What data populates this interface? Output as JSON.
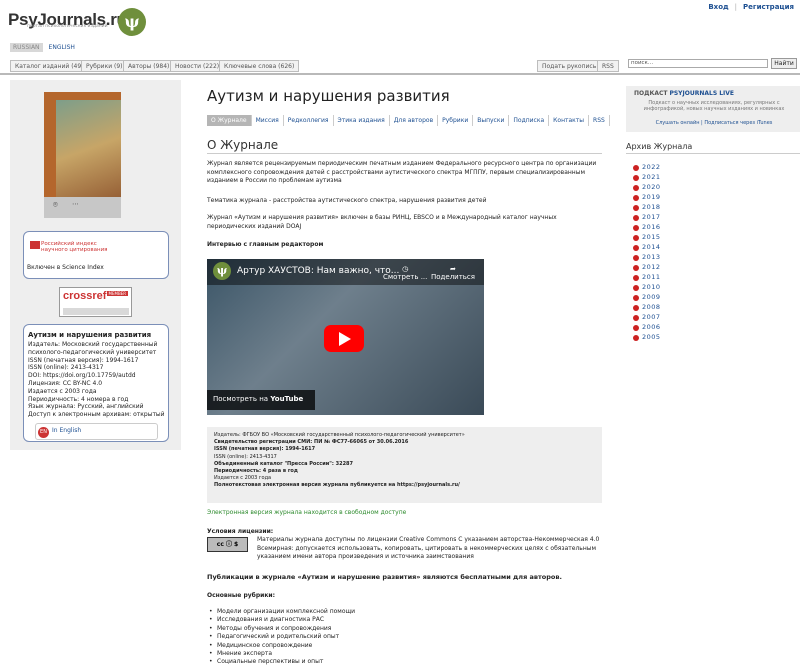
{
  "site": {
    "logo": "PsyJournals.ru",
    "subtitle": "портал психологических изданий",
    "logo_icon": "psi-icon"
  },
  "auth": {
    "login": "Вход",
    "register": "Регистрация"
  },
  "langs": [
    "RUSSIAN",
    "ENGLISH"
  ],
  "nav": {
    "tabs": [
      "Каталог изданий (49)",
      "Рубрики (9)",
      "Авторы (984)",
      "Новости (222)",
      "Ключевые слова (626)"
    ],
    "subscribe": "Подать рукопись",
    "rss": "RSS",
    "search_placeholder": "поиск...",
    "search_btn": "Найти"
  },
  "sidebar": {
    "cover_icons": [
      "camera-icon",
      "more-icon"
    ],
    "rinc": {
      "title": "Российский индекс научного цитирования",
      "line": "Включен в Science Index"
    },
    "crossref": {
      "name": "crossref",
      "badge": "MEMBER"
    },
    "info": {
      "title": "Аутизм и нарушения развития",
      "lines": [
        "Издатель: Московский государственный психолого-педагогический университет",
        "ISSN (печатная версия): 1994-1617",
        "ISSN (online): 2413-4317",
        "DOI: https://doi.org/10.17759/autdd",
        "Лицензия: CC BY-NC 4.0",
        "Издается с 2003 года",
        "Периодичность: 4 номера в год",
        "Язык журнала: Русский, английский",
        "Доступ к электронным архивам: открытый"
      ]
    },
    "eng": {
      "badge": "EN",
      "label": "In English"
    }
  },
  "main": {
    "title": "Аутизм и нарушения развития",
    "tabs": [
      "О Журнале",
      "Миссия",
      "Редколлегия",
      "Этика издания",
      "Для авторов",
      "Рубрики",
      "Выпуски",
      "Подписка",
      "Контакты",
      "RSS"
    ],
    "about_heading": "О Журнале",
    "para1": "Журнал является рецензируемым периодическим печатным изданием Федерального ресурсного центра по организации комплексного сопровождения детей с расстройствами аутистического спектра МГППУ, первым специализированным изданием в России по проблемам аутизма",
    "para2": "Тематика журнала - расстройства аутистического спектра, нарушения развития детей",
    "para3": "Журнал «Аутизм и нарушения развития» включен в базы РИНЦ, EBSCO и в Международный каталог научных периодических изданий DOAJ",
    "interview": "Интервью с главным редактором",
    "video": {
      "title": "Артур ХАУСТОВ: Нам важно, что...",
      "watch_later": "Смотреть ...",
      "share": "Поделиться",
      "watch_on": "Посмотреть на",
      "youtube": "YouTube"
    },
    "registry": [
      "Издатель: ФГБОУ ВО «Московский государственный психолого-педагогический университет»",
      "Свидетельство регистрации СМИ: ПИ № ФС77-66065 от 30.06.2016",
      "ISSN (печатная версия): 1994-1617",
      "ISSN (online): 2413-4317",
      "Объединенный каталог \"Пресса России\": 32287",
      "Периодичность: 4 раза в год",
      "Издается с 2003 года",
      "Полнотекстовая электронная версия журнала публикуется на https://psyjournals.ru/"
    ],
    "free": "Электронная версия журнала находится в свободном доступе",
    "license_head": "Условия лицензии:",
    "cc_icon": "cc-by-nc-icon",
    "license": "Материалы журнала доступны по лицензии Creative Commons С указанием авторства-Некоммерческая 4.0 Всемирная: допускается использовать, копировать, цитировать в некоммерческих целях с обязательным указанием имени автора произведения и источника заимствования",
    "pub": "Публикации в журнале «Аутизм и нарушение развития» являются бесплатными для авторов.",
    "rub_head": "Основные рубрики:",
    "rubrics": [
      "Модели организации комплексной помощи",
      "Исследования и диагностика РАС",
      "Методы обучения и сопровождения",
      "Педагогический и родительский опыт",
      "Медицинское сопровождение",
      "Мнение эксперта",
      "Социальные перспективы и опыт"
    ]
  },
  "right": {
    "live_title": "ПОДКАСТ",
    "live_brand": "PSYJOURNALS LIVE",
    "live_desc": "Подкаст о научных исследованиях, регулярных с инфографикой, новых научных изданиях и новинках",
    "live_links": "Слушать онлайн | Подписаться через iTunes",
    "archive": "Архив Журнала",
    "years": [
      "2022",
      "2021",
      "2020",
      "2019",
      "2018",
      "2017",
      "2016",
      "2015",
      "2014",
      "2013",
      "2012",
      "2011",
      "2010",
      "2009",
      "2008",
      "2007",
      "2006",
      "2005"
    ]
  }
}
